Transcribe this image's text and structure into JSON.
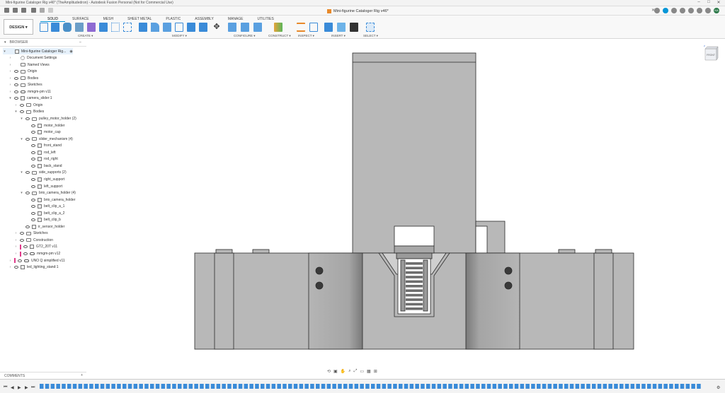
{
  "titlebar": {
    "title": "Mini-figurine Cataloger Rig v46* (TheAmplitudedron) - Autodesk Fusion Personal (Not for Commercial Use)",
    "minimize": "–",
    "maximize": "□",
    "close": "✕"
  },
  "document_tab": {
    "name": "Mini-figurine Cataloger Rig v46*",
    "close": "✕"
  },
  "user_initials": "KA",
  "toolbar": {
    "workspace": "DESIGN ▾",
    "tabs": [
      "SOLID",
      "SURFACE",
      "MESH",
      "SHEET METAL",
      "PLASTIC",
      "ASSEMBLY",
      "MANAGE",
      "UTILITIES"
    ],
    "active_tab": "SOLID",
    "groups": [
      "CREATE ▾",
      "MODIFY ▾",
      "CONFIGURE ▾",
      "CONSTRUCT ▾",
      "INSPECT ▾",
      "INSERT ▾",
      "SELECT ▾"
    ]
  },
  "browser": {
    "title": "BROWSER",
    "rows": [
      {
        "label": "Mini-figurine Cataloger Rig...",
        "depth": 0,
        "icon": "component",
        "chev": "▾",
        "selected": true
      },
      {
        "label": "Document Settings",
        "depth": 1,
        "icon": "gear",
        "chev": "›"
      },
      {
        "label": "Named Views",
        "depth": 1,
        "icon": "folder",
        "chev": "›"
      },
      {
        "label": "Origin",
        "depth": 1,
        "icon": "folder",
        "chev": "›",
        "eye": true
      },
      {
        "label": "Bodies",
        "depth": 1,
        "icon": "folder",
        "chev": "›",
        "eye": true
      },
      {
        "label": "Sketches",
        "depth": 1,
        "icon": "folder",
        "chev": "›",
        "eye": true
      },
      {
        "label": "mmgm-pm v11",
        "depth": 1,
        "icon": "link",
        "chev": "›",
        "eye": true
      },
      {
        "label": "camera_slider:1",
        "depth": 1,
        "icon": "component",
        "chev": "▾",
        "eye": true
      },
      {
        "label": "Origin",
        "depth": 2,
        "icon": "folder",
        "chev": "›",
        "eye": true
      },
      {
        "label": "Bodies",
        "depth": 2,
        "icon": "folder",
        "chev": "▾",
        "eye": true
      },
      {
        "label": "pulley_motor_holder (2)",
        "depth": 3,
        "icon": "folder",
        "chev": "▾",
        "eye": true
      },
      {
        "label": "motor_holder",
        "depth": 4,
        "icon": "body",
        "eye": true
      },
      {
        "label": "motor_cap",
        "depth": 4,
        "icon": "body",
        "eye": true
      },
      {
        "label": "slider_mechanism (4)",
        "depth": 3,
        "icon": "folder",
        "chev": "▾",
        "eye": true
      },
      {
        "label": "front_stand",
        "depth": 4,
        "icon": "body",
        "eye": true
      },
      {
        "label": "rod_left",
        "depth": 4,
        "icon": "body",
        "eye": true
      },
      {
        "label": "rod_right",
        "depth": 4,
        "icon": "body",
        "eye": true
      },
      {
        "label": "back_stand",
        "depth": 4,
        "icon": "body",
        "eye": true
      },
      {
        "label": "side_supports (2)",
        "depth": 3,
        "icon": "folder",
        "chev": "▾",
        "eye": true
      },
      {
        "label": "right_support",
        "depth": 4,
        "icon": "body",
        "eye": true
      },
      {
        "label": "left_support",
        "depth": 4,
        "icon": "body",
        "eye": true
      },
      {
        "label": "brio_camera_holder (4)",
        "depth": 3,
        "icon": "folder",
        "chev": "▾",
        "eye": true
      },
      {
        "label": "brio_camera_holder",
        "depth": 4,
        "icon": "body",
        "eye": true
      },
      {
        "label": "belt_clip_a_1",
        "depth": 4,
        "icon": "body",
        "eye": true
      },
      {
        "label": "belt_clip_a_2",
        "depth": 4,
        "icon": "body",
        "eye": true
      },
      {
        "label": "belt_clip_b",
        "depth": 4,
        "icon": "body",
        "eye": true
      },
      {
        "label": "ir_sensor_holder",
        "depth": 3,
        "icon": "body",
        "eye": true
      },
      {
        "label": "Sketches",
        "depth": 2,
        "icon": "folder",
        "chev": "›",
        "eye": true
      },
      {
        "label": "Construction",
        "depth": 2,
        "icon": "folder",
        "chev": "›",
        "eye": true
      },
      {
        "label": "GT2_20T v11",
        "depth": 2,
        "icon": "component",
        "chev": "›",
        "eye": true,
        "flag": true
      },
      {
        "label": "mmgm-pm v12",
        "depth": 2,
        "icon": "link",
        "chev": "›",
        "eye": true,
        "flag": true
      },
      {
        "label": "UNO Q simplified v11",
        "depth": 1,
        "icon": "link",
        "chev": "›",
        "eye": true,
        "flag": true
      },
      {
        "label": "led_lighting_stand:1",
        "depth": 1,
        "icon": "component",
        "chev": "›",
        "eye": true
      }
    ]
  },
  "comments": {
    "label": "COMMENTS",
    "add": "+"
  },
  "viewcube": {
    "face": "FRONT",
    "axis": "Z"
  },
  "timeline": {
    "first": "⏮",
    "prev": "◀",
    "play": "▶",
    "next": "▶",
    "last": "⏭"
  },
  "colors": {
    "accent": "#0696d7",
    "model_fill": "#b7b7b7",
    "model_edge": "#2a2a2a"
  }
}
